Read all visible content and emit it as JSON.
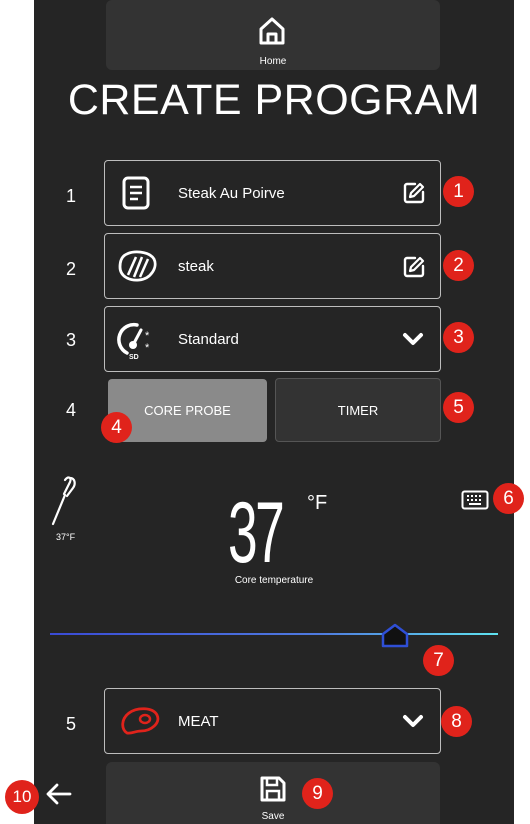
{
  "header": {
    "home_label": "Home"
  },
  "title": "CREATE PROGRAM",
  "rows": {
    "r1": {
      "num": "1",
      "label": "Steak Au Poirve"
    },
    "r2": {
      "num": "2",
      "label": "steak"
    },
    "r3": {
      "num": "3",
      "label": "Standard"
    },
    "r4": {
      "num": "4",
      "core_probe": "CORE PROBE",
      "timer": "TIMER"
    },
    "r5": {
      "num": "5",
      "label": "MEAT"
    }
  },
  "probe": {
    "small_reading": "37°F"
  },
  "temperature": {
    "value": "37",
    "unit": "°F",
    "label": "Core temperature"
  },
  "slider": {
    "value_fraction": 0.77
  },
  "footer": {
    "save_label": "Save"
  },
  "badges": [
    "1",
    "2",
    "3",
    "4",
    "5",
    "6",
    "7",
    "8",
    "9",
    "10"
  ],
  "colors": {
    "background": "#252525",
    "button": "#333333",
    "active_tab": "#8a8a8a",
    "badge": "#e0231b",
    "slider_start": "#3a4bd6",
    "slider_end": "#5fe3f0"
  }
}
